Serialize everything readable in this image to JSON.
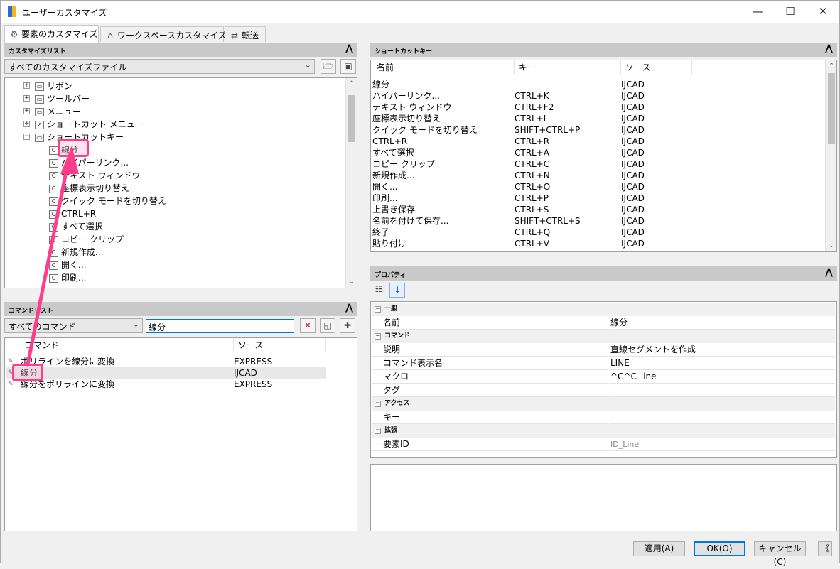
{
  "window": {
    "title": "ユーザーカスタマイズ",
    "minimize": "—",
    "maximize": "☐",
    "close": "✕"
  },
  "tabs": [
    {
      "label": "要素のカスタマイズ",
      "icon": "gear-icon",
      "glyph": "⚙"
    },
    {
      "label": "ワークスペースカスタマイズ",
      "icon": "home-icon",
      "glyph": "⌂"
    },
    {
      "label": "転送",
      "icon": "transfer-icon",
      "glyph": "⇄"
    }
  ],
  "customize_list": {
    "header": "カスタマイズリスト",
    "collapse": "⋀",
    "dropdown": "すべてのカスタマイズファイル",
    "tree": [
      {
        "label": "リボン",
        "toggle": "+",
        "icon": "▭"
      },
      {
        "label": "ツールバー",
        "toggle": "+",
        "icon": "▭"
      },
      {
        "label": "メニュー",
        "toggle": "+",
        "icon": "▭"
      },
      {
        "label": "ショートカット メニュー",
        "toggle": "+",
        "icon": "↗"
      },
      {
        "label": "ショートカットキー",
        "toggle": "−",
        "icon": "▭"
      },
      {
        "label": "線分",
        "icon": "C"
      },
      {
        "label": "ハイパーリンク...",
        "icon": "C"
      },
      {
        "label": "テキスト ウィンドウ",
        "icon": "C"
      },
      {
        "label": "座標表示切り替え",
        "icon": "C"
      },
      {
        "label": "クイック モードを切り替え",
        "icon": "C"
      },
      {
        "label": "CTRL+R",
        "icon": "C"
      },
      {
        "label": "すべて選択",
        "icon": "C"
      },
      {
        "label": "コピー クリップ",
        "icon": "C"
      },
      {
        "label": "新規作成...",
        "icon": "C"
      },
      {
        "label": "開く...",
        "icon": "C"
      },
      {
        "label": "印刷...",
        "icon": "C"
      }
    ]
  },
  "command_list": {
    "header": "コマンドリスト",
    "collapse": "⋀",
    "dropdown": "すべてのコマンド",
    "search_value": "線分",
    "columns": [
      "コマンド",
      "ソース"
    ],
    "rows": [
      {
        "name": "ポリラインを線分に変換",
        "source": "EXPRESS"
      },
      {
        "name": "線分",
        "source": "IJCAD"
      },
      {
        "name": "線分をポリラインに変換",
        "source": "EXPRESS"
      }
    ]
  },
  "shortcut_keys": {
    "header": "ショートカットキー",
    "collapse": "⋀",
    "columns": [
      "名前",
      "キー",
      "ソース"
    ],
    "rows": [
      {
        "name": "線分",
        "key": "",
        "source": "IJCAD"
      },
      {
        "name": "ハイパーリンク...",
        "key": "CTRL+K",
        "source": "IJCAD"
      },
      {
        "name": "テキスト ウィンドウ",
        "key": "CTRL+F2",
        "source": "IJCAD"
      },
      {
        "name": "座標表示切り替え",
        "key": "CTRL+I",
        "source": "IJCAD"
      },
      {
        "name": "クイック モードを切り替え",
        "key": "SHIFT+CTRL+P",
        "source": "IJCAD"
      },
      {
        "name": "CTRL+R",
        "key": "CTRL+R",
        "source": "IJCAD"
      },
      {
        "name": "すべて選択",
        "key": "CTRL+A",
        "source": "IJCAD"
      },
      {
        "name": "コピー クリップ",
        "key": "CTRL+C",
        "source": "IJCAD"
      },
      {
        "name": "新規作成...",
        "key": "CTRL+N",
        "source": "IJCAD"
      },
      {
        "name": "開く...",
        "key": "CTRL+O",
        "source": "IJCAD"
      },
      {
        "name": "印刷...",
        "key": "CTRL+P",
        "source": "IJCAD"
      },
      {
        "name": "上書き保存",
        "key": "CTRL+S",
        "source": "IJCAD"
      },
      {
        "name": "名前を付けて保存...",
        "key": "SHIFT+CTRL+S",
        "source": "IJCAD"
      },
      {
        "name": "終了",
        "key": "CTRL+Q",
        "source": "IJCAD"
      },
      {
        "name": "貼り付け",
        "key": "CTRL+V",
        "source": "IJCAD"
      }
    ]
  },
  "properties": {
    "header": "プロパティ",
    "collapse": "⋀",
    "groups": [
      {
        "title": "一般",
        "rows": [
          {
            "k": "名前",
            "v": "線分"
          }
        ]
      },
      {
        "title": "コマンド",
        "rows": [
          {
            "k": "説明",
            "v": "直線セグメントを作成"
          },
          {
            "k": "コマンド表示名",
            "v": "LINE"
          },
          {
            "k": "マクロ",
            "v": "^C^C_line"
          },
          {
            "k": "タグ",
            "v": ""
          }
        ]
      },
      {
        "title": "アクセス",
        "rows": [
          {
            "k": "キー",
            "v": ""
          }
        ]
      },
      {
        "title": "拡張",
        "rows": [
          {
            "k": "要素ID",
            "v": "ID_Line"
          }
        ]
      }
    ]
  },
  "buttons": {
    "apply": "適用(A)",
    "ok": "OK(O)",
    "cancel": "キャンセル(C)",
    "toggle": "《"
  },
  "colors": {
    "highlight": "#ff3d8b",
    "accent": "#0078d7"
  }
}
